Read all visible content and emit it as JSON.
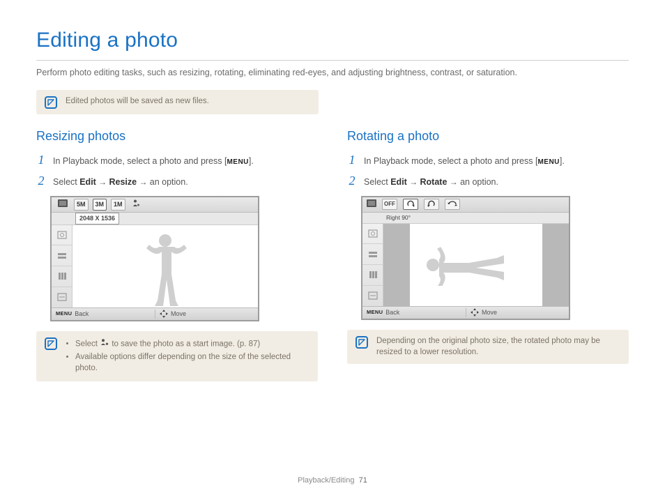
{
  "title": "Editing a photo",
  "intro": "Perform photo editing tasks, such as resizing, rotating, eliminating red-eyes, and adjusting brightness, contrast, or saturation.",
  "top_note": "Edited photos will be saved as new files.",
  "left": {
    "heading": "Resizing photos",
    "step1_pre": "In Playback mode, select a photo and press [",
    "step1_menu": "MENU",
    "step1_post": "].",
    "step2_select": "Select ",
    "step2_edit": "Edit",
    "step2_arrow1": " → ",
    "step2_resize": "Resize",
    "step2_arrow2": " → ",
    "step2_option": "an option.",
    "screen": {
      "size_opts": [
        "5M",
        "3M",
        "1M"
      ],
      "resolution": "2048 X 1536",
      "back": "Back",
      "move": "Move",
      "menu_lbl": "MENU"
    },
    "note_li1_a": "Select ",
    "note_li1_b": " to save the photo as a start image. (p. 87)",
    "note_li2": "Available options differ depending on the size of the selected photo."
  },
  "right": {
    "heading": "Rotating a photo",
    "step1_pre": "In Playback mode, select a photo and press [",
    "step1_menu": "MENU",
    "step1_post": "].",
    "step2_select": "Select ",
    "step2_edit": "Edit",
    "step2_arrow1": " → ",
    "step2_rotate": "Rotate",
    "step2_arrow2": " → ",
    "step2_option": "an option.",
    "screen": {
      "off": "OFF",
      "right90": "Right 90°",
      "back": "Back",
      "move": "Move",
      "menu_lbl": "MENU"
    },
    "note": "Depending on the original photo size, the rotated photo may be resized to a lower resolution."
  },
  "footer": {
    "section": "Playback/Editing",
    "page": "71"
  }
}
